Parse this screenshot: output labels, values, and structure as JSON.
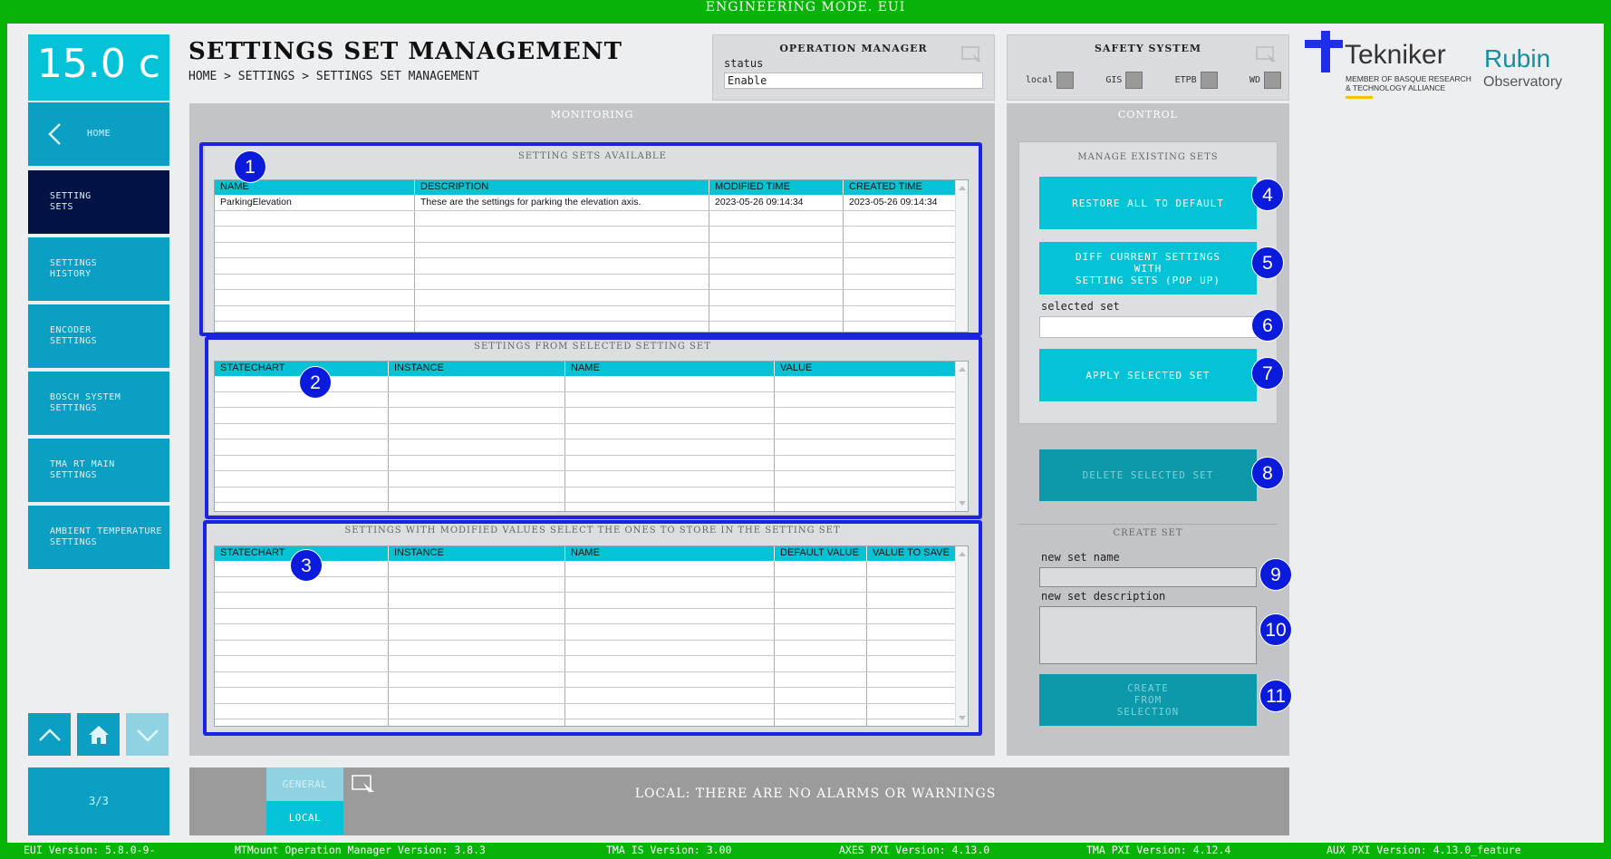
{
  "window": {
    "title": "ENGINEERING MODE. EUI"
  },
  "temperature": "15.0 c",
  "nav": {
    "home": "HOME",
    "items": [
      {
        "label": "SETTING\nSETS",
        "active": true
      },
      {
        "label": "SETTINGS\nHISTORY",
        "active": false
      },
      {
        "label": "ENCODER\nSETTINGS",
        "active": false
      },
      {
        "label": "BOSCH SYSTEM\nSETTINGS",
        "active": false
      },
      {
        "label": "TMA RT MAIN\nSETTINGS",
        "active": false
      },
      {
        "label": "AMBIENT TEMPERATURE\nSETTINGS",
        "active": false
      }
    ],
    "page_indicator": "3/3"
  },
  "header": {
    "title": "SETTINGS SET MANAGEMENT",
    "breadcrumb": "HOME > SETTINGS > SETTINGS SET MANAGEMENT"
  },
  "operation_manager": {
    "title": "OPERATION MANAGER",
    "status_label": "status",
    "status_value": "Enable"
  },
  "safety_system": {
    "title": "SAFETY SYSTEM",
    "items": [
      "local",
      "GIS",
      "ETPB",
      "WD"
    ]
  },
  "logos": {
    "tekniker_name": "Tekniker",
    "tekniker_tagline_1": "MEMBER OF BASQUE RESEARCH",
    "tekniker_tagline_2": "& TECHNOLOGY ALLIANCE",
    "rubin_1": "Rubin",
    "rubin_2": "Observatory"
  },
  "monitoring": {
    "title": "MONITORING",
    "available": {
      "title": "SETTING SETS AVAILABLE",
      "columns": [
        "NAME",
        "DESCRIPTION",
        "MODIFIED TIME",
        "CREATED TIME"
      ],
      "rows": [
        [
          "ParkingElevation",
          "These are the settings for parking the elevation axis.",
          "2023-05-26 09:14:34",
          "2023-05-26 09:14:34"
        ]
      ]
    },
    "selected": {
      "title": "SETTINGS FROM SELECTED SETTING SET",
      "columns": [
        "STATECHART",
        "INSTANCE",
        "NAME",
        "VALUE"
      ]
    },
    "modified": {
      "title": "SETTINGS WITH MODIFIED VALUES SELECT THE ONES TO STORE IN THE SETTING SET",
      "columns": [
        "STATECHART",
        "INSTANCE",
        "NAME",
        "DEFAULT VALUE",
        "VALUE TO SAVE"
      ]
    }
  },
  "control": {
    "title": "CONTROL",
    "manage_title": "MANAGE EXISTING SETS",
    "restore_label": "RESTORE ALL TO DEFAULT",
    "diff_label": "DIFF CURRENT SETTINGS\nWITH\nSETTING SETS (POP UP)",
    "selected_set_label": "selected set",
    "selected_set_value": "",
    "apply_label": "APPLY SELECTED SET",
    "delete_label": "DELETE SELECTED SET",
    "create_title": "CREATE SET",
    "new_name_label": "new set name",
    "new_desc_label": "new set description",
    "create_label": "CREATE\nFROM\nSELECTION"
  },
  "badges": [
    "1",
    "2",
    "3",
    "4",
    "5",
    "6",
    "7",
    "8",
    "9",
    "10",
    "11"
  ],
  "alarms": {
    "tab_general": "GENERAL",
    "tab_local": "LOCAL",
    "message": "LOCAL: THERE ARE NO ALARMS OR WARNINGS"
  },
  "footer": {
    "eui": "EUI Version: 5.8.0-9-",
    "opman": "MTMount Operation Manager Version: 3.8.3",
    "tmais": "TMA IS Version: 3.00",
    "axes": "AXES PXI Version: 4.13.0",
    "tmapxi": "TMA PXI Version: 4.12.4",
    "aux": "AUX PXI Version: 4.13.0_feature"
  },
  "colors": {
    "frame": "#07b307",
    "accent": "#04c3d7",
    "nav": "#0a9fc3",
    "nav_active": "#021244",
    "highlight": "#1a23e0"
  }
}
